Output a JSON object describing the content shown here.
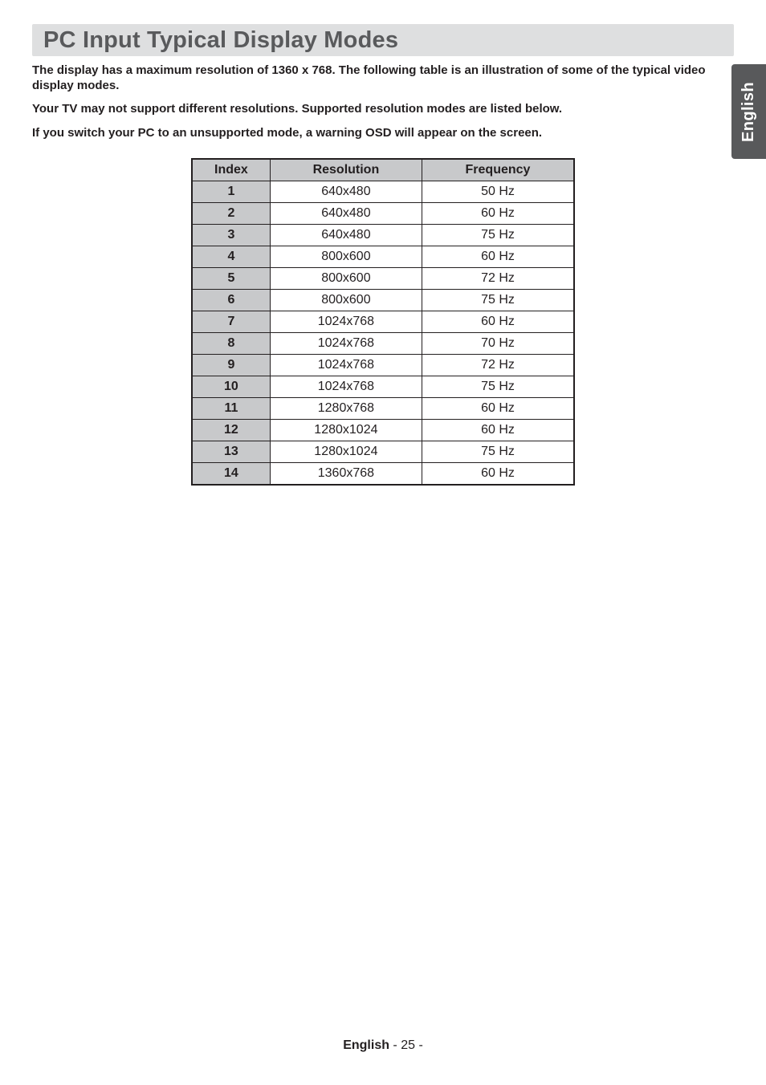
{
  "side_tab": "English",
  "title": "PC Input Typical Display Modes",
  "intro": {
    "p1": "The display has a maximum resolution of 1360 x 768. The following table is an illustration of some of the typical video display modes.",
    "p2": "Your TV may not support different resolutions. Supported resolution modes are listed below.",
    "p3": "If you switch your PC to an unsupported mode, a warning OSD will appear on the screen."
  },
  "table": {
    "headers": {
      "index": "Index",
      "resolution": "Resolution",
      "frequency": "Frequency"
    },
    "rows": [
      {
        "index": "1",
        "resolution": "640x480",
        "frequency": "50 Hz"
      },
      {
        "index": "2",
        "resolution": "640x480",
        "frequency": "60 Hz"
      },
      {
        "index": "3",
        "resolution": "640x480",
        "frequency": "75 Hz"
      },
      {
        "index": "4",
        "resolution": "800x600",
        "frequency": "60 Hz"
      },
      {
        "index": "5",
        "resolution": "800x600",
        "frequency": "72 Hz"
      },
      {
        "index": "6",
        "resolution": "800x600",
        "frequency": "75 Hz"
      },
      {
        "index": "7",
        "resolution": "1024x768",
        "frequency": "60 Hz"
      },
      {
        "index": "8",
        "resolution": "1024x768",
        "frequency": "70 Hz"
      },
      {
        "index": "9",
        "resolution": "1024x768",
        "frequency": "72 Hz"
      },
      {
        "index": "10",
        "resolution": "1024x768",
        "frequency": "75 Hz"
      },
      {
        "index": "11",
        "resolution": "1280x768",
        "frequency": "60 Hz"
      },
      {
        "index": "12",
        "resolution": "1280x1024",
        "frequency": "60 Hz"
      },
      {
        "index": "13",
        "resolution": "1280x1024",
        "frequency": "75 Hz"
      },
      {
        "index": "14",
        "resolution": "1360x768",
        "frequency": "60 Hz"
      }
    ]
  },
  "footer": {
    "language": "English",
    "sep": "  - ",
    "page": "25 -"
  }
}
